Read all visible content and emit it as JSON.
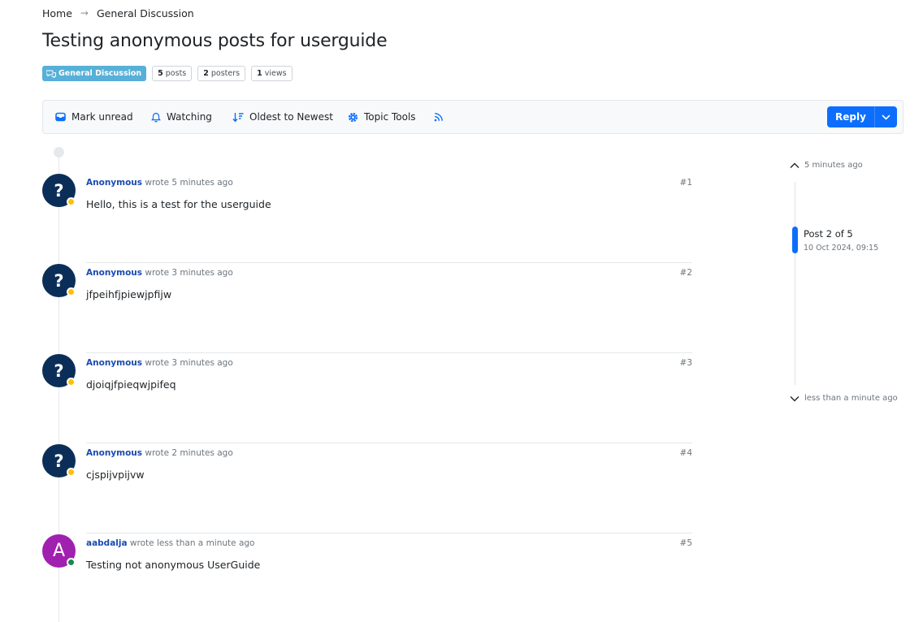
{
  "breadcrumb": {
    "home": "Home",
    "current": "General Discussion"
  },
  "topic": {
    "title": "Testing anonymous posts for userguide",
    "category": "General Discussion",
    "category_color": "#57b0d8",
    "stats": {
      "posts_count": "5",
      "posts_label": "posts",
      "posters_count": "2",
      "posters_label": "posters",
      "views_count": "1",
      "views_label": "views"
    }
  },
  "toolbar": {
    "mark_unread": "Mark unread",
    "watching": "Watching",
    "sort": "Oldest to Newest",
    "topic_tools": "Topic Tools",
    "reply": "Reply",
    "accent_color": "#0d6efd",
    "icons": [
      "inbox-icon",
      "bell-icon",
      "sort-icon",
      "gear-icon",
      "rss-icon",
      "chevron-down-icon"
    ]
  },
  "posts": [
    {
      "author": "Anonymous",
      "verb": "wrote",
      "time": "5 minutes ago",
      "index": "#1",
      "content": "Hello, this is a test for the userguide",
      "avatar": "?",
      "status": "away"
    },
    {
      "author": "Anonymous",
      "verb": "wrote",
      "time": "3 minutes ago",
      "index": "#2",
      "content": "jfpeihfjpiewjpfijw",
      "avatar": "?",
      "status": "away"
    },
    {
      "author": "Anonymous",
      "verb": "wrote",
      "time": "3 minutes ago",
      "index": "#3",
      "content": "djoiqjfpieqwjpifeq",
      "avatar": "?",
      "status": "away"
    },
    {
      "author": "Anonymous",
      "verb": "wrote",
      "time": "2 minutes ago",
      "index": "#4",
      "content": "cjspijvpijvw",
      "avatar": "?",
      "status": "away"
    },
    {
      "author": "aabdalja",
      "verb": "wrote",
      "time": "less than a minute ago",
      "index": "#5",
      "content": "Testing not anonymous UserGuide",
      "avatar": "A",
      "status": "online"
    }
  ],
  "navigator": {
    "top_time": "5 minutes ago",
    "current": "Post 2 of 5",
    "date": "10 Oct 2024, 09:15",
    "bottom_time": "less than a minute ago"
  }
}
